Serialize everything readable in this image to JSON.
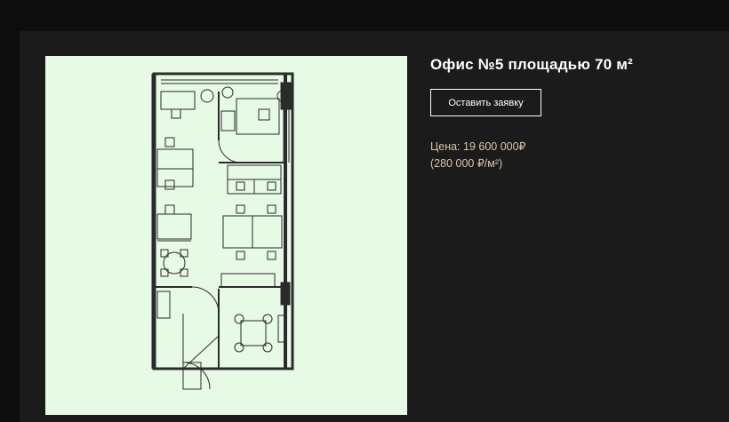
{
  "listing": {
    "title": "Офис №5 площадью 70 м²",
    "cta_label": "Оставить заявку",
    "price_line": "Цена: 19 600 000₽",
    "price_per_m2_line": "(280 000 ₽/м²)"
  },
  "colors": {
    "page_bg": "#0d0d0d",
    "panel_bg": "#1b1b1b",
    "plan_bg": "#e6fae6",
    "price_text": "#d7c6a6"
  },
  "floor_plan": {
    "icon": "office-floor-plan"
  }
}
